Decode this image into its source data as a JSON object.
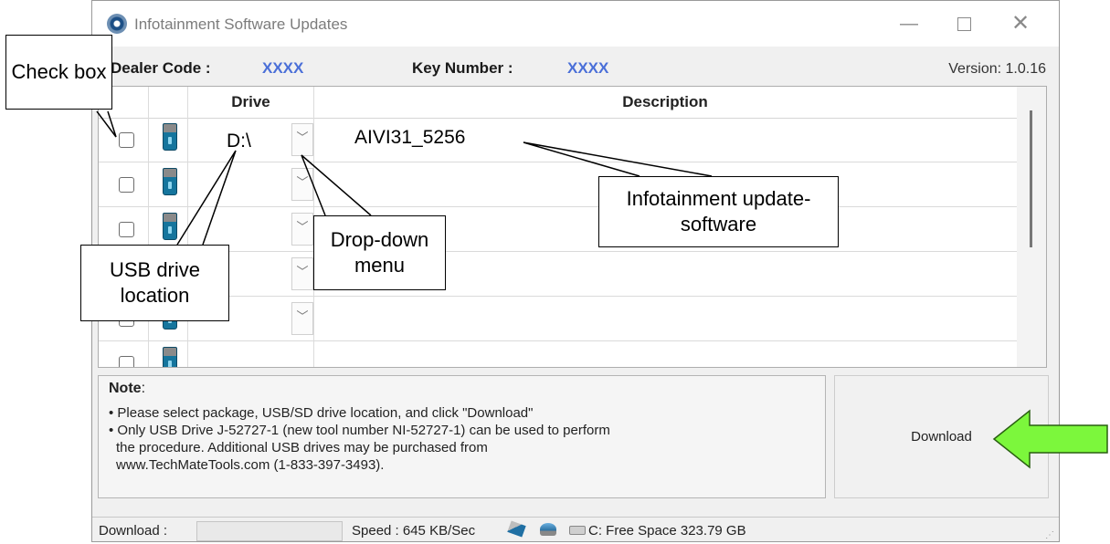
{
  "window": {
    "title": "Infotainment Software Updates",
    "controls": {
      "minimize": "—",
      "maximize": "",
      "close": "✕"
    }
  },
  "info": {
    "dealer_code_label": "Dealer Code :",
    "dealer_code_value": "XXXX",
    "key_number_label": "Key Number :",
    "key_number_value": "XXXX",
    "version": "Version: 1.0.16"
  },
  "grid": {
    "headers": {
      "drive": "Drive",
      "description": "Description"
    },
    "rows": [
      {
        "drive": "D:\\",
        "description": "AIVI31_5256"
      },
      {
        "drive": "",
        "description": ""
      },
      {
        "drive": "",
        "description": ""
      },
      {
        "drive": "",
        "description": ""
      },
      {
        "drive": "",
        "description": ""
      }
    ]
  },
  "note": {
    "title": "Note",
    "lines": [
      "• Please select package, USB/SD drive location, and click \"Download\"",
      "• Only USB Drive J-52727-1 (new tool number NI-52727-1) can be used to perform",
      "  the procedure. Additional USB drives may be purchased from",
      "  www.TechMateTools.com (1-833-397-3493)."
    ]
  },
  "download_button": "Download",
  "status": {
    "download_label": "Download :",
    "progress": 0,
    "speed": "Speed : 645 KB/Sec",
    "free_space": "C: Free Space 323.79 GB"
  },
  "annotations": {
    "check_box": "Check box",
    "usb_drive_location": "USB drive location",
    "drop_down_menu": "Drop-down menu",
    "infotainment_software": "Infotainment update-software"
  },
  "colors": {
    "arrow": "#7cf73c",
    "value_blue": "#4a6fd8"
  }
}
